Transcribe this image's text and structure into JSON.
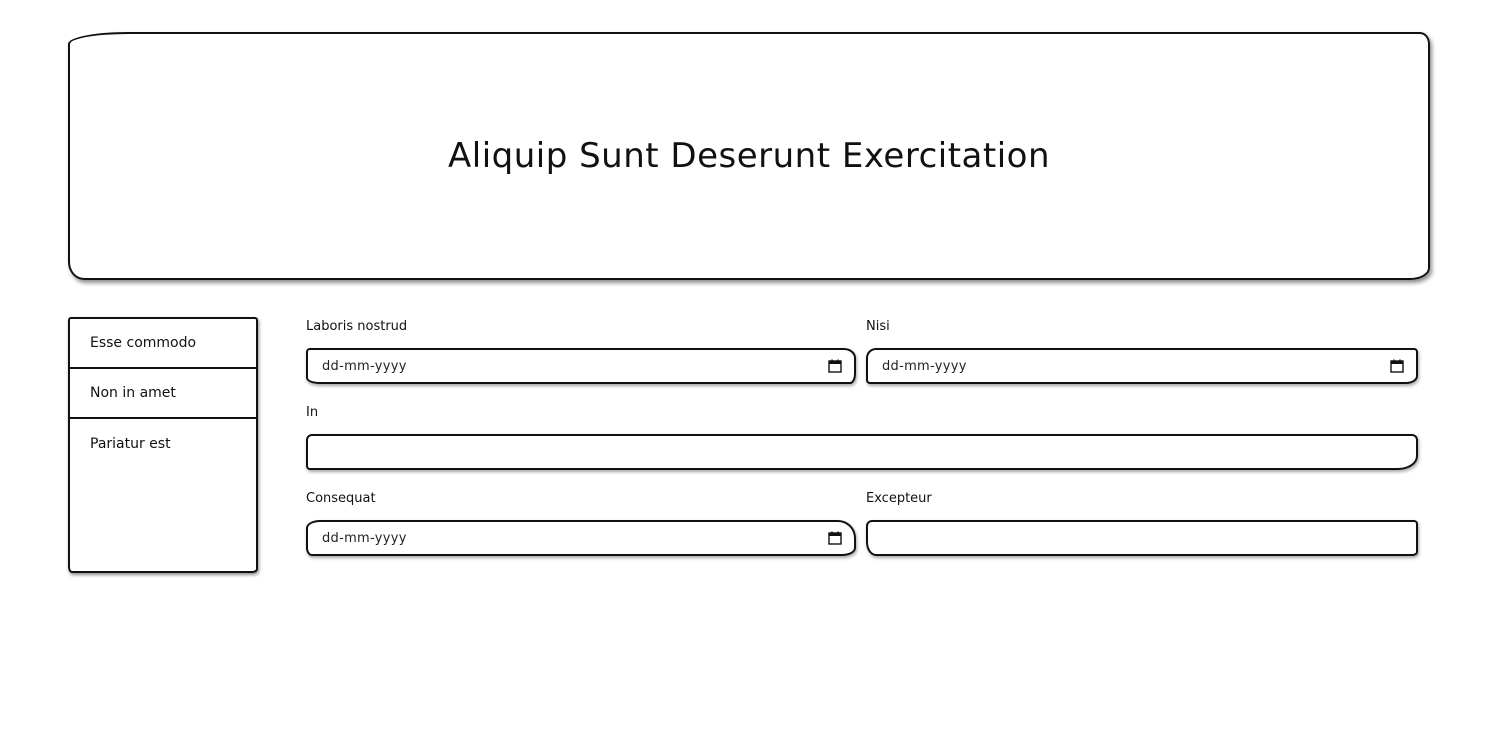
{
  "header": {
    "title": "Aliquip Sunt Deserunt Exercitation"
  },
  "sidebar": {
    "items": [
      {
        "label": "Esse commodo"
      },
      {
        "label": "Non in amet"
      },
      {
        "label": "Pariatur est"
      }
    ]
  },
  "form": {
    "fields": [
      {
        "label": "Laboris nostrud",
        "type": "date",
        "placeholder": "dd-mm-yyyy",
        "value": ""
      },
      {
        "label": "Nisi",
        "type": "date",
        "placeholder": "dd-mm-yyyy",
        "value": ""
      },
      {
        "label": "In",
        "type": "text",
        "placeholder": "",
        "value": ""
      },
      {
        "label": "Consequat",
        "type": "date",
        "placeholder": "dd-mm-yyyy",
        "value": ""
      },
      {
        "label": "Excepteur",
        "type": "text",
        "placeholder": "",
        "value": ""
      }
    ]
  },
  "icons": {
    "calendar": "calendar-icon"
  }
}
